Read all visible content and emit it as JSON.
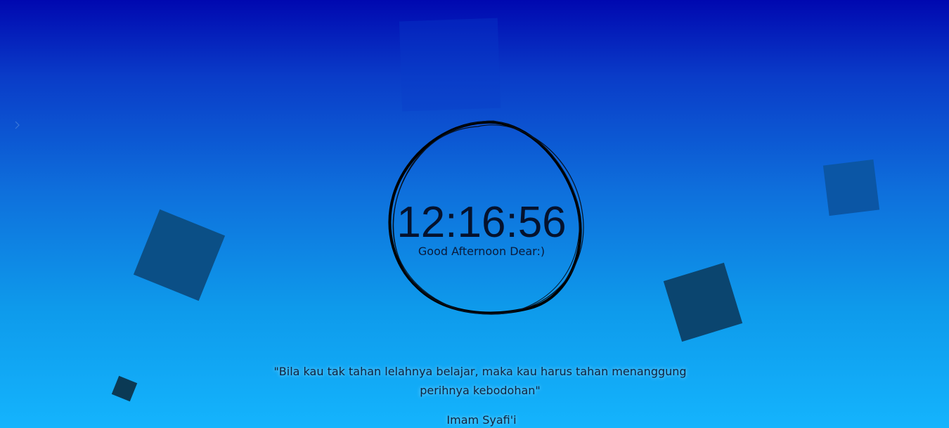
{
  "clock": {
    "time": "12:16:56",
    "greeting": "Good Afternoon Dear:)"
  },
  "quote": {
    "text": "\"Bila kau tak tahan lelahnya belajar, maka kau harus tahan menanggung perihnya kebodohan\"",
    "author": "Imam Syafi'i"
  },
  "icons": {
    "side_toggle": "chevron-right-icon",
    "clock_frame": "scribble-circle-icon"
  },
  "colors": {
    "background_top": "#0008b0",
    "background_bottom": "#14b4fd",
    "text": "#05122d"
  }
}
